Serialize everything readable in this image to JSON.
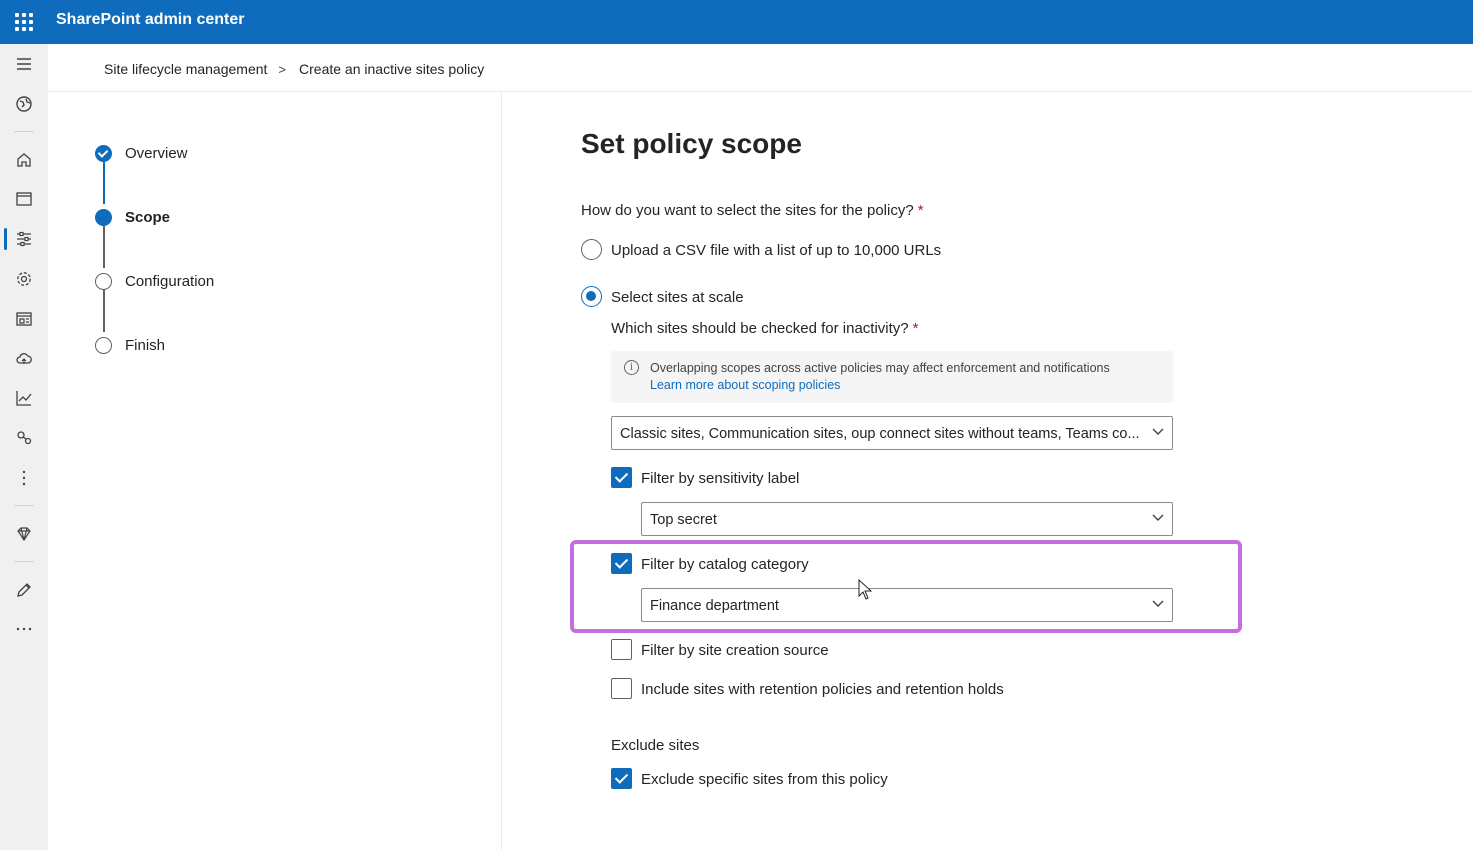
{
  "topbar": {
    "app_title": "SharePoint admin center",
    "waffle_icon": "app-launcher-icon",
    "bg_color": "#0f6cbd"
  },
  "leftnav": {
    "icons": [
      "hamburger-icon",
      "globe-icon",
      "home-icon",
      "sites-icon",
      "policies-icon",
      "settings-icon",
      "content-services-icon",
      "migration-icon",
      "reports-icon",
      "advanced-icon",
      "more-icon",
      "premium-icon",
      "customize-icon",
      "ellipsis-icon"
    ],
    "active_index": 4
  },
  "breadcrumb": {
    "parent": "Site lifecycle management",
    "separator": ">",
    "current": "Create an inactive sites policy"
  },
  "stepper": {
    "steps": [
      {
        "label": "Overview",
        "state": "done"
      },
      {
        "label": "Scope",
        "state": "current"
      },
      {
        "label": "Configuration",
        "state": "pending"
      },
      {
        "label": "Finish",
        "state": "pending"
      }
    ]
  },
  "main": {
    "title": "Set policy scope",
    "question": "How do you want to select the sites for the policy?",
    "required_mark": "*",
    "options": [
      {
        "label": "Upload a CSV file with a list of up to 10,000 URLs",
        "checked": false
      },
      {
        "label": "Select sites at scale",
        "checked": true
      }
    ],
    "sites_question": "Which sites should be checked for inactivity?",
    "info": {
      "text": "Overlapping scopes across active policies may affect enforcement and notifications",
      "link": "Learn more about scoping policies",
      "icon": "info-icon"
    },
    "site_types_dropdown": {
      "value": "Classic sites, Communication sites, oup connect sites without teams, Teams co..."
    },
    "filters": [
      {
        "label": "Filter by sensitivity label",
        "checked": true,
        "dropdown_value": "Top secret"
      },
      {
        "label": "Filter by catalog category",
        "checked": true,
        "dropdown_value": "Finance department"
      },
      {
        "label": "Filter by site creation source",
        "checked": false
      },
      {
        "label": "Include sites with retention policies and retention holds",
        "checked": false
      }
    ],
    "exclude": {
      "title": "Exclude sites",
      "option": {
        "label": "Exclude specific sites from this policy",
        "checked": true
      }
    },
    "highlight_color": "#c46ee2"
  }
}
